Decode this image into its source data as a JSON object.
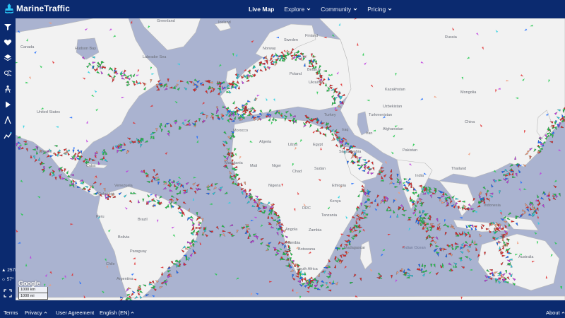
{
  "brand": {
    "name": "MarineTraffic",
    "logo_icon": "ship-logo-icon",
    "color": "#0b2a6f"
  },
  "nav": {
    "items": [
      {
        "label": "Live Map",
        "active": true,
        "dropdown": false
      },
      {
        "label": "Explore",
        "active": false,
        "dropdown": true
      },
      {
        "label": "Community",
        "active": false,
        "dropdown": true
      },
      {
        "label": "Pricing",
        "active": false,
        "dropdown": true
      }
    ]
  },
  "sidebar": {
    "tools": [
      "filter-icon",
      "heart-icon",
      "layers-icon",
      "weather-icon",
      "density-icon",
      "play-icon",
      "measure-icon",
      "analytics-icon"
    ],
    "vessel_count": "257K",
    "temperature": "57°",
    "fullscreen_icon": "fullscreen-icon"
  },
  "map": {
    "country_labels": [
      "Greenland",
      "Iceland",
      "Canada",
      "Hudson Bay",
      "Labrador Sea",
      "Sweden",
      "Finland",
      "Norway",
      "Russia",
      "Poland",
      "Belarus",
      "Ukraine",
      "Kazakhstan",
      "Mongolia",
      "Spain",
      "Turkey",
      "Uzbekistan",
      "Turkmenistan",
      "Afghanistan",
      "Iran",
      "Iraq",
      "United States",
      "Mexico",
      "Cuba",
      "Venezuela",
      "Colombia",
      "Peru",
      "Brazil",
      "Bolivia",
      "Paraguay",
      "Chile",
      "Argentina",
      "Morocco",
      "Algeria",
      "Libya",
      "Egypt",
      "Saudi Arabia",
      "Mauritania",
      "Mali",
      "Niger",
      "Chad",
      "Sudan",
      "Nigeria",
      "Ethiopia",
      "DRC",
      "Kenya",
      "Tanzania",
      "Angola",
      "Zambia",
      "Namibia",
      "Botswana",
      "South Africa",
      "Madagascar",
      "Pakistan",
      "India",
      "China",
      "Thailand",
      "Indonesia",
      "Australia"
    ],
    "ocean_labels": [
      "Indian Ocean"
    ],
    "vessel_colors": {
      "cargo": "#1fc94a",
      "tanker": "#e12b2b",
      "passenger": "#1b6bff",
      "fishing": "#f09a7a",
      "tug": "#24d0e0",
      "pleasure": "#c03be0"
    },
    "land_color": "#f2f2f2",
    "water_color": "#aab3d0",
    "attribution": "Google",
    "scale": [
      "1000 km",
      "1000 mi"
    ]
  },
  "footer": {
    "left": [
      {
        "label": "Terms",
        "dropdown": false
      },
      {
        "label": "Privacy",
        "dropdown": true
      },
      {
        "label": "User Agreement",
        "dropdown": false
      },
      {
        "label": "English (EN)",
        "dropdown": true
      }
    ],
    "right": {
      "label": "About",
      "dropdown": true
    }
  }
}
